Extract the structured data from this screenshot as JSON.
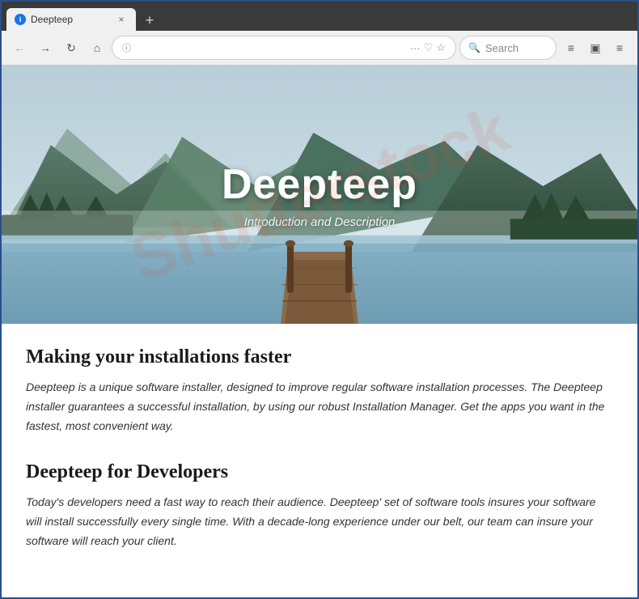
{
  "browser": {
    "tab": {
      "icon": "i",
      "title": "Deepteep",
      "close_label": "×"
    },
    "tab_new_label": "+",
    "nav": {
      "back_label": "←",
      "forward_label": "→",
      "refresh_label": "↻",
      "home_label": "⌂",
      "url_icon": "ⓘ",
      "url_text": "",
      "more_label": "···",
      "bookmark_label": "♡",
      "star_label": "☆",
      "search_placeholder": "Search",
      "reader_label": "≡",
      "sidebar_label": "▣",
      "menu_label": "≡",
      "scrollbar_label": "▼"
    },
    "window_controls": {
      "minimize": "−",
      "maximize": "□",
      "close": "×"
    }
  },
  "page": {
    "hero": {
      "title": "Deepteep",
      "subtitle": "Introduction and Description"
    },
    "watermark": "Shutterstock",
    "sections": [
      {
        "title": "Making your installations faster",
        "text": "Deepteep is a unique software installer, designed to improve regular software installation processes. The Deepteep installer guarantees a successful installation, by using our robust Installation Manager. Get the apps you want in the fastest, most convenient way."
      },
      {
        "title": "Deepteep for Developers",
        "text": "Today's developers need a fast way to reach their audience. Deepteep' set of software tools insures your software will install successfully every single time. With a decade-long experience under our belt, our team can insure your software will reach your client."
      }
    ]
  }
}
